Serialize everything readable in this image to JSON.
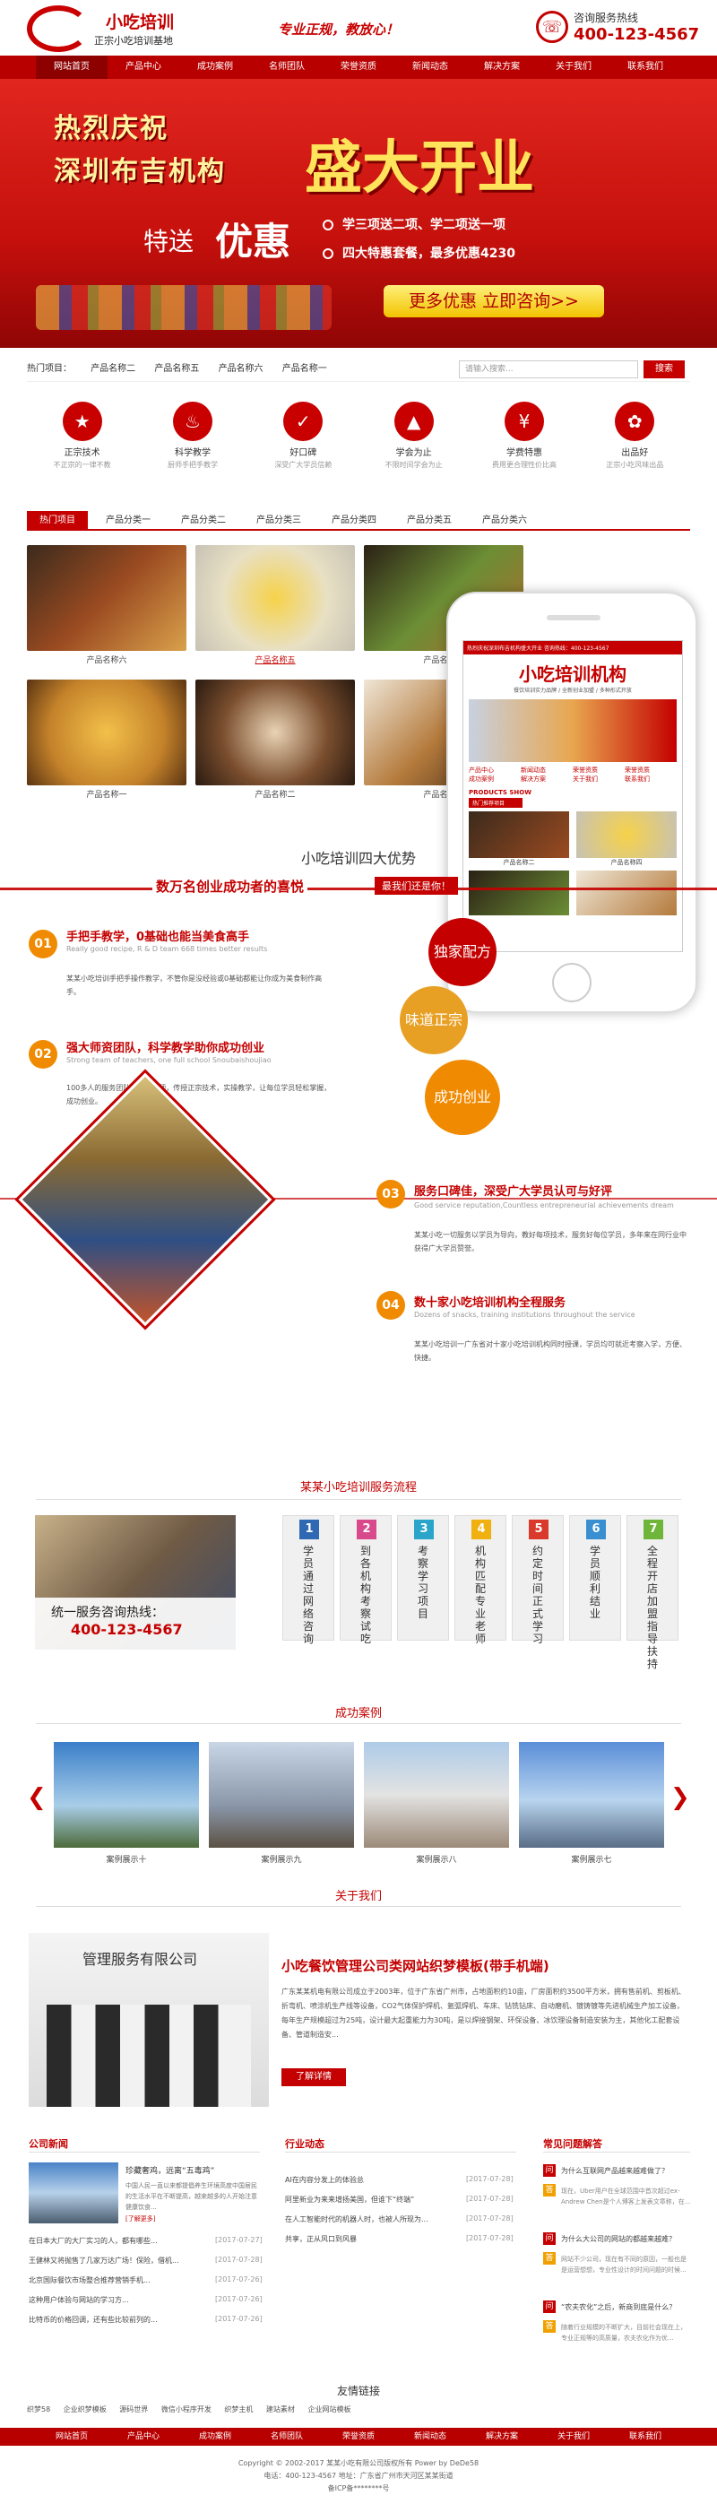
{
  "header": {
    "logo_title": "小吃培训",
    "logo_sub": "正宗小吃培训基地",
    "slogan": "专业正规，教放心！",
    "hotline_label": "咨询服务热线",
    "hotline": "400-123-4567"
  },
  "nav": [
    "网站首页",
    "产品中心",
    "成功案例",
    "名师团队",
    "荣誉资质",
    "新闻动态",
    "解决方案",
    "关于我们",
    "联系我们"
  ],
  "banner": {
    "line1": "热烈庆祝",
    "line2": "深圳布吉机构",
    "big": "盛大开业",
    "special": "特送",
    "offer": "优惠",
    "item1": "学三项送二项、学二项送一项",
    "item2": "四大特惠套餐，最多优惠4230",
    "btn": "更多优惠  立即咨询>>"
  },
  "crumb": {
    "label": "热门项目：",
    "items": [
      "产品名称二",
      "产品名称五",
      "产品名称六",
      "产品名称一"
    ],
    "search_placeholder": "请输入搜索...",
    "search_btn": "搜索"
  },
  "features": [
    {
      "icon": "award-icon",
      "title": "正宗技术",
      "sub": "不正宗的一律不教"
    },
    {
      "icon": "chef-icon",
      "title": "科学教学",
      "sub": "厨师手把手教学"
    },
    {
      "icon": "thumb-icon",
      "title": "好口碑",
      "sub": "深受广大学员信赖"
    },
    {
      "icon": "grad-icon",
      "title": "学会为止",
      "sub": "不限时间学会为止"
    },
    {
      "icon": "yen-icon",
      "title": "学费特惠",
      "sub": "费用更合理性价比高"
    },
    {
      "icon": "award-icon",
      "title": "出品好",
      "sub": "正宗小吃风味出品"
    }
  ],
  "tabs": [
    "热门项目",
    "产品分类一",
    "产品分类二",
    "产品分类三",
    "产品分类四",
    "产品分类五",
    "产品分类六"
  ],
  "products": [
    "产品名称六",
    "产品名称五",
    "产品名称四",
    "产品名称一",
    "产品名称二",
    "产品名称三"
  ],
  "phone": {
    "header": "热烈庆祝深圳布吉机构盛大开业 咨询热线：400-123-4567",
    "title": "小吃培训机构",
    "subtitle": "餐饮培训实力品牌 / 全新创业加盟 / 多种形式开放",
    "menu": [
      "产品中心",
      "新闻动态",
      "荣誉资质",
      "荣誉资质",
      "成功案例",
      "解决方案",
      "关于我们",
      "联系我们"
    ],
    "label": "PRODUCTS SHOW",
    "sub_label": "热门推荐项目",
    "prod1": "产品名称二",
    "prod2": "产品名称四"
  },
  "advantage": {
    "title": "小吃培训四大优势",
    "sub": "数万名创业成功者的喜悦",
    "tag": "最我们还是你！",
    "items": [
      {
        "n": "01",
        "h": "手把手教学，0基础也能当美食高手",
        "e": "Really good recipe, R & D team 668 times better results",
        "p": "某某小吃培训手把手操作教学，不管你是没经验或0基础都能让你成为美食制作高手。"
      },
      {
        "n": "02",
        "h": "强大师资团队，科学教学助你成功创业",
        "e": "Strong team of teachers, one full school Snoubaishoujiao",
        "p": "100多人的服务团队，专业老师，传授正宗技术，实操教学，让每位学员轻松掌握，成功创业。"
      },
      {
        "n": "03",
        "h": "服务口碑佳，深受广大学员认可与好评",
        "e": "Good service reputation,Countless entrepreneurial achievements dream",
        "p": "某某小吃一切服务以学员为导向，教好每项技术，服务好每位学员，多年来在同行业中获得广大学员赞誉。"
      },
      {
        "n": "04",
        "h": "数十家小吃培训机构全程服务",
        "e": "Dozens of snacks, training institutions throughout the service",
        "p": "某某小吃培训一广东省对十家小吃培训机构同时授课，学员均可就近考察入学，方便、快捷。"
      }
    ],
    "circles": [
      "独家配方",
      "味道正宗",
      "成功创业"
    ]
  },
  "process": {
    "title": "某某小吃培训服务流程",
    "consult_label": "统一服务咨询热线：",
    "hotline": "400-123-4567",
    "steps": [
      {
        "n": "1",
        "t": "学员通过网络咨询"
      },
      {
        "n": "2",
        "t": "到各机构考察试吃"
      },
      {
        "n": "3",
        "t": "考察学习项目"
      },
      {
        "n": "4",
        "t": "机构匹配专业老师"
      },
      {
        "n": "5",
        "t": "约定时间正式学习"
      },
      {
        "n": "6",
        "t": "学员顺利结业"
      },
      {
        "n": "7",
        "t": "全程开店加盟指导扶持"
      }
    ]
  },
  "cases": {
    "title": "成功案例",
    "items": [
      "案例展示十",
      "案例展示九",
      "案例展示八",
      "案例展示七"
    ]
  },
  "about": {
    "title": "关于我们",
    "heading": "小吃餐饮管理公司类网站织梦模板(带手机端)",
    "text": "广东某某机电有限公司成立于2003年，位于广东省广州市，占地面积约10亩，厂房面积约3500平方米，拥有售前机、剪板机、折弯机、喷涂机生产线等设备，CO2气体保护焊机、氩弧焊机、车床、钻铣钻床、自动磨机、镀铸镀等先进机械生产加工设备，每年生产规模超过为25吨，设计最大起重能力为30吨，是以焊接钢架、环保设备、冰饮理设备制造安装为主，其他化工配套设备、管道制造安...",
    "btn": "了解详情",
    "sign": "管理服务有限公司"
  },
  "news": {
    "title": "公司新闻",
    "lead_title": "珍藏奢鸡，远离“五毒鸡”",
    "lead_text": "中国人民一直以来都提倡养生环境高度中国居民的生活水平在不断提高，越来越多的人开始注意健康饮食...",
    "more": "[了解更多]",
    "items": [
      {
        "t": "在日本大厂的大厂实习的人，都有哪些...",
        "d": "[2017-07-27]"
      },
      {
        "t": "王健林又将抛售了几家万达广场！保险，借机...",
        "d": "[2017-07-28]"
      },
      {
        "t": "北京国际餐饮市场整合推荐营销手机...",
        "d": "[2017-07-26]"
      },
      {
        "t": "这种用户体验与网站的学习方...",
        "d": "[2017-07-26]"
      },
      {
        "t": "比特币的价格回调，还有些比较前列的...",
        "d": "[2017-07-26]"
      }
    ]
  },
  "industry": {
    "title": "行业动态",
    "items": [
      {
        "t": "AI在内容分发上的体验总",
        "d": "[2017-07-28]"
      },
      {
        "t": "阿里新业为来来增扬美国，但谁下“终端”",
        "d": "[2017-07-28]"
      },
      {
        "t": "在人工智能时代的机器人时，也被人所现为...",
        "d": "[2017-07-28]"
      },
      {
        "t": "共享，正从风口到风暴",
        "d": "[2017-07-28]"
      }
    ]
  },
  "faq": {
    "title": "常见问题解答",
    "items": [
      {
        "q": "为什么互联网产品越来越难做了？",
        "a": "现在，Uber用户在全球范围中首次超过ex-Andrew Chen是个人博客上发表文章称，在..."
      },
      {
        "q": "为什么大公司的网站的都越来越难？",
        "a": "网站不少公司，现在有不同的原因，一般也是是运营想想，专业性设计的时间问题的时候..."
      },
      {
        "q": "“农夫农化”之后，新商到底是什么？",
        "a": "随着行业规模的不断扩大，目前社会现在上，专业正规等的高质量，农夫农化作为优..."
      }
    ]
  },
  "links": {
    "title": "友情链接",
    "items": [
      "织梦58",
      "企业织梦模板",
      "源码世界",
      "微信小程序开发",
      "织梦主机",
      "建站素材",
      "企业网站模板"
    ]
  },
  "footer": {
    "nav": [
      "网站首页",
      "产品中心",
      "成功案例",
      "名师团队",
      "荣誉资质",
      "新闻动态",
      "解决方案",
      "关于我们",
      "联系我们"
    ],
    "copyright": "Copyright © 2002-2017 某某小吃有限公司版权所有 Power by DeDe58",
    "contact": "电话：400-123-4567    地址：广东省广州市天河区某某街道",
    "icp": "备ICP备********号"
  },
  "colors": {
    "brand": "#c40000",
    "accent": "#f08a00"
  }
}
